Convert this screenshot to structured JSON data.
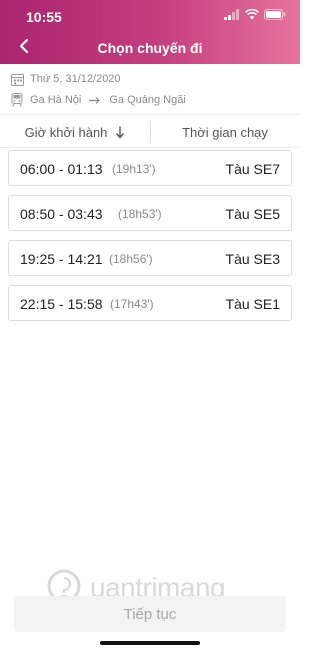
{
  "status_bar": {
    "time": "10:55"
  },
  "header": {
    "title": "Chọn chuyến đi"
  },
  "trip": {
    "date": "Thứ 5, 31/12/2020",
    "from": "Ga Hà Nội",
    "to": "Ga Quảng Ngãi"
  },
  "sort": {
    "departure_label": "Giờ khởi hành",
    "duration_label": "Thời gian chạy"
  },
  "trains": [
    {
      "time": "06:00 - 01:13",
      "duration": "(19h13')",
      "name": "Tàu SE7"
    },
    {
      "time": "08:50 - 03:43",
      "duration": "(18h53')",
      "name": "Tàu SE5"
    },
    {
      "time": "19:25 - 14:21",
      "duration": "(18h56')",
      "name": "Tàu SE3"
    },
    {
      "time": "22:15 - 15:58",
      "duration": "(17h43')",
      "name": "Tàu SE1"
    }
  ],
  "watermark": {
    "text": "uantrimang"
  },
  "footer": {
    "continue_label": "Tiếp tục"
  },
  "colors": {
    "header_start": "#a8246e",
    "header_end": "#e6739e"
  }
}
